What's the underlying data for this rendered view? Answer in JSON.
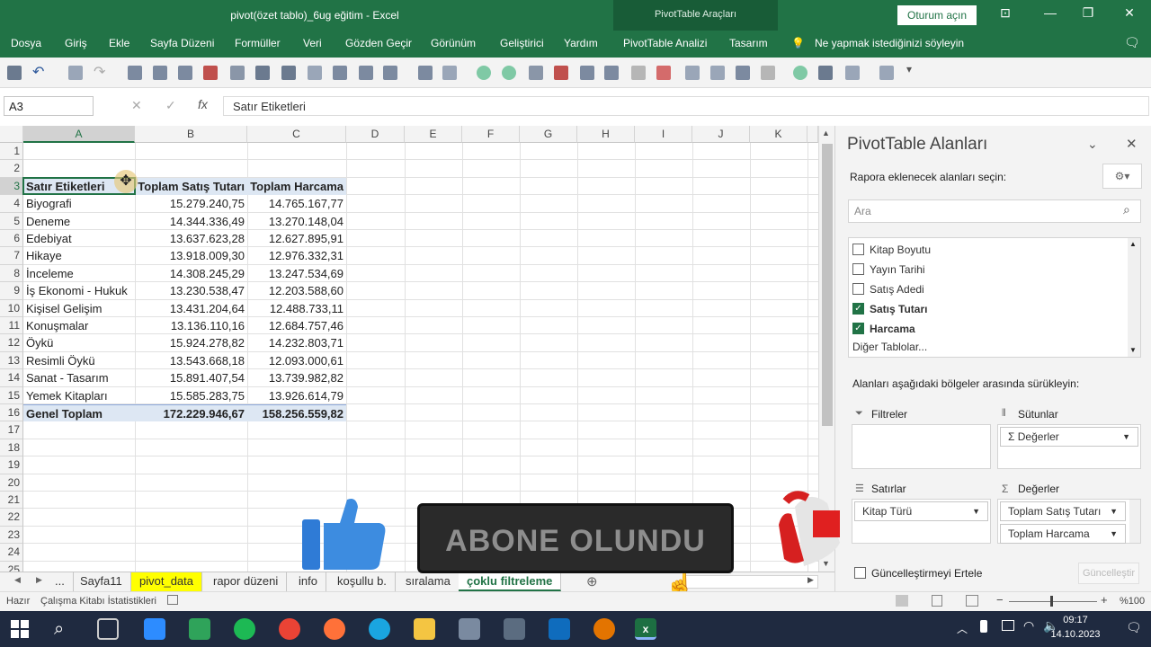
{
  "window": {
    "title": "pivot(özet tablo)_6ug eğitim  -  Excel",
    "context_tab": "PivotTable Araçları",
    "signin_label": "Oturum açın"
  },
  "menu": [
    "Dosya",
    "Giriş",
    "Ekle",
    "Sayfa Düzeni",
    "Formüller",
    "Veri",
    "Gözden Geçir",
    "Görünüm",
    "Geliştirici",
    "Yardım",
    "PivotTable Analizi",
    "Tasarım"
  ],
  "tell_me": "Ne yapmak istediğinizi söyleyin",
  "formula_bar": {
    "name_box": "A3",
    "formula": "Satır Etiketleri"
  },
  "columns": [
    "A",
    "B",
    "C",
    "D",
    "E",
    "F",
    "G",
    "H",
    "I",
    "J",
    "K"
  ],
  "rows": [
    "1",
    "2",
    "3",
    "4",
    "5",
    "6",
    "7",
    "8",
    "9",
    "10",
    "11",
    "12",
    "13",
    "14",
    "15",
    "16",
    "17",
    "18",
    "19",
    "20",
    "21",
    "22",
    "23",
    "24",
    "25"
  ],
  "pivot": {
    "headers": [
      "Satır Etiketleri",
      "Toplam Satış Tutarı",
      "Toplam Harcama"
    ],
    "rows": [
      [
        "Biyografi",
        "15.279.240,75",
        "14.765.167,77"
      ],
      [
        "Deneme",
        "14.344.336,49",
        "13.270.148,04"
      ],
      [
        "Edebiyat",
        "13.637.623,28",
        "12.627.895,91"
      ],
      [
        "Hikaye",
        "13.918.009,30",
        "12.976.332,31"
      ],
      [
        "İnceleme",
        "14.308.245,29",
        "13.247.534,69"
      ],
      [
        "İş Ekonomi - Hukuk",
        "13.230.538,47",
        "12.203.588,60"
      ],
      [
        "Kişisel Gelişim",
        "13.431.204,64",
        "12.488.733,11"
      ],
      [
        "Konuşmalar",
        "13.136.110,16",
        "12.684.757,46"
      ],
      [
        "Öykü",
        "15.924.278,82",
        "14.232.803,71"
      ],
      [
        "Resimli Öykü",
        "13.543.668,18",
        "12.093.000,61"
      ],
      [
        "Sanat - Tasarım",
        "15.891.407,54",
        "13.739.982,82"
      ],
      [
        "Yemek Kitapları",
        "15.585.283,75",
        "13.926.614,79"
      ]
    ],
    "total": [
      "Genel Toplam",
      "172.229.946,67",
      "158.256.559,82"
    ]
  },
  "sheet_tabs": [
    "...",
    "Sayfa11",
    "pivot_data",
    "rapor düzeni",
    "info",
    "koşullu b.",
    "sıralama",
    "çoklu filtreleme"
  ],
  "status": {
    "ready": "Hazır",
    "stats": "Çalışma Kitabı İstatistikleri",
    "zoom": "%100"
  },
  "pane": {
    "title": "PivotTable Alanları",
    "choose_label": "Rapora eklenecek alanları seçin:",
    "search_placeholder": "Ara",
    "fields": [
      {
        "label": "Kitap Boyutu",
        "checked": false
      },
      {
        "label": "Yayın Tarihi",
        "checked": false
      },
      {
        "label": "Satış Adedi",
        "checked": false
      },
      {
        "label": "Satış Tutarı",
        "checked": true
      },
      {
        "label": "Harcama",
        "checked": true
      }
    ],
    "more_tables": "Diğer Tablolar...",
    "drag_label": "Alanları aşağıdaki bölgeler arasında sürükleyin:",
    "filters_label": "Filtreler",
    "columns_label": "Sütunlar",
    "rows_label": "Satırlar",
    "values_label": "Değerler",
    "columns_item": "Değerler",
    "rows_item": "Kitap Türü",
    "values_items": [
      "Toplam Satış Tutarı",
      "Toplam Harcama"
    ],
    "defer_label": "Güncelleştirmeyi Ertele",
    "update_button": "Güncelleştir"
  },
  "overlay": {
    "text": "ABONE OLUNDU"
  },
  "taskbar": {
    "time": "09:17",
    "date": "14.10.2023"
  }
}
